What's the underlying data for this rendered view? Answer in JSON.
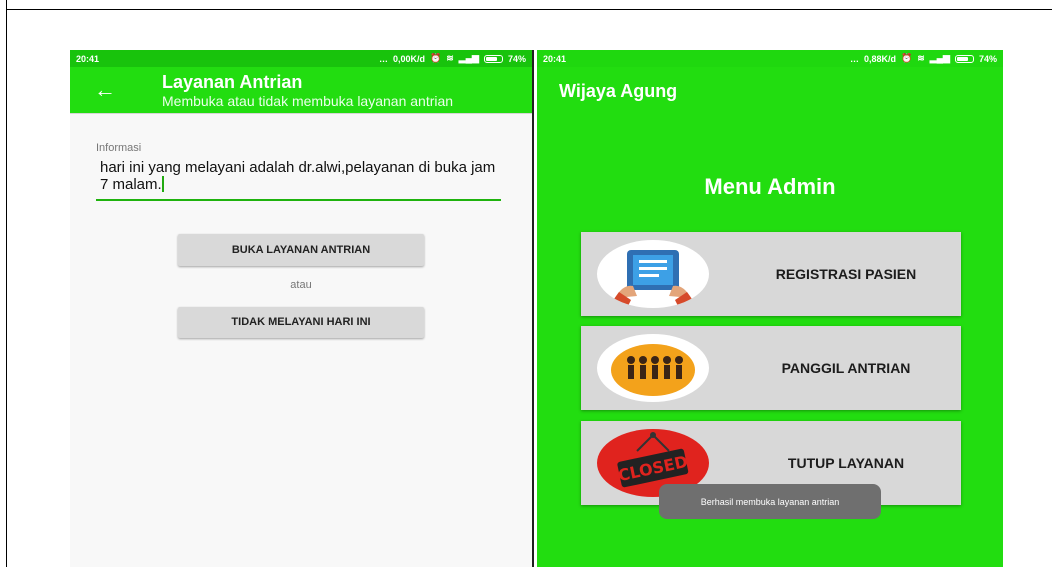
{
  "left_phone": {
    "status_bar": {
      "time": "20:41",
      "speed": "0,00K/d",
      "battery": "74%"
    },
    "app_bar": {
      "title": "Layanan Antrian",
      "subtitle": "Membuka atau tidak membuka layanan antrian"
    },
    "info": {
      "label": "Informasi",
      "text": "hari ini yang melayani adalah dr.alwi,pelayanan di buka jam 7 malam."
    },
    "buttons": {
      "open": "BUKA LAYANAN ANTRIAN",
      "or": "atau",
      "close": "TIDAK MELAYANI HARI INI"
    }
  },
  "right_phone": {
    "status_bar": {
      "time": "20:41",
      "speed": "0,88K/d",
      "battery": "74%"
    },
    "app_bar": {
      "title": "Wijaya Agung"
    },
    "menu_title": "Menu Admin",
    "cards": [
      {
        "label": "REGISTRASI PASIEN",
        "icon": "tablet-hands-icon"
      },
      {
        "label": "PANGGIL ANTRIAN",
        "icon": "people-queue-icon"
      },
      {
        "label": "TUTUP LAYANAN",
        "icon": "closed-sign-icon"
      }
    ],
    "toast": "Berhasil membuka layanan antrian"
  },
  "colors": {
    "accent": "#22dd10",
    "status_bar": "#18c30c",
    "card": "#d8d8d8",
    "toast": "#6f6f6f"
  }
}
